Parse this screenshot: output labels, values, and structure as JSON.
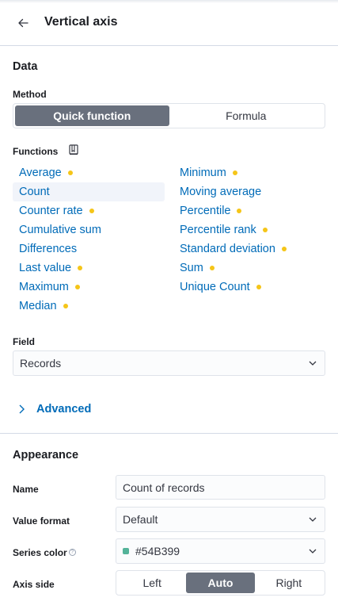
{
  "header": {
    "title": "Vertical axis"
  },
  "data_section": {
    "title": "Data",
    "method_label": "Method",
    "method_options": [
      "Quick function",
      "Formula"
    ],
    "method_selected": "Quick function",
    "functions_label": "Functions",
    "functions_left": [
      {
        "label": "Average",
        "dot": true
      },
      {
        "label": "Count",
        "dot": false,
        "selected": true
      },
      {
        "label": "Counter rate",
        "dot": true
      },
      {
        "label": "Cumulative sum",
        "dot": false
      },
      {
        "label": "Differences",
        "dot": false
      },
      {
        "label": "Last value",
        "dot": true
      },
      {
        "label": "Maximum",
        "dot": true
      },
      {
        "label": "Median",
        "dot": true
      }
    ],
    "functions_right": [
      {
        "label": "Minimum",
        "dot": true
      },
      {
        "label": "Moving average",
        "dot": false
      },
      {
        "label": "Percentile",
        "dot": true
      },
      {
        "label": "Percentile rank",
        "dot": true
      },
      {
        "label": "Standard deviation",
        "dot": true
      },
      {
        "label": "Sum",
        "dot": true
      },
      {
        "label": "Unique Count",
        "dot": true
      }
    ],
    "field_label": "Field",
    "field_value": "Records",
    "advanced_label": "Advanced"
  },
  "appearance": {
    "title": "Appearance",
    "name_label": "Name",
    "name_value": "Count of records",
    "value_format_label": "Value format",
    "value_format_value": "Default",
    "series_color_label": "Series color",
    "series_color_value": "#54B399",
    "series_color_hex": "#54B399",
    "axis_side_label": "Axis side",
    "axis_side_options": [
      "Left",
      "Auto",
      "Right"
    ],
    "axis_side_selected": "Auto"
  },
  "colors": {
    "accent_link": "#006bb8",
    "dot": "#f5c518",
    "active_segment": "#69707d"
  }
}
